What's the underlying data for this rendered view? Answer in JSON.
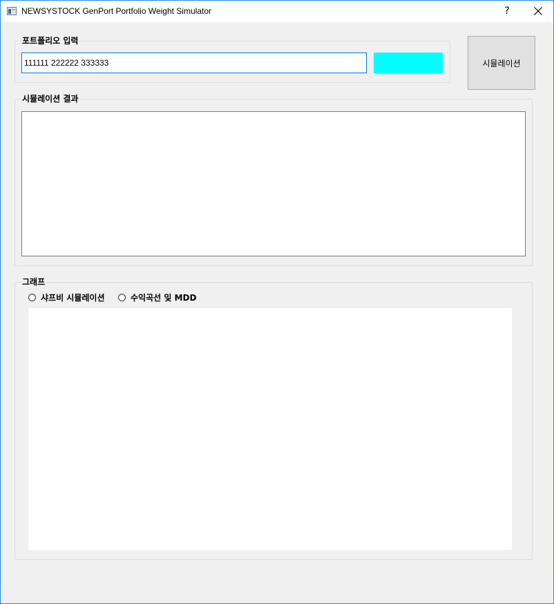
{
  "window": {
    "title": "NEWSYSTOCK GenPort Portfolio Weight Simulator",
    "help_label": "?",
    "accent_color": "#1e88e5"
  },
  "portfolio_group": {
    "title": "포트폴리오 입력",
    "input_value": "111111 222222 333333",
    "indicator_color": "#00ffff"
  },
  "simulate_button": {
    "label": "시뮬레이션"
  },
  "result_group": {
    "title": "시뮬레이션 결과",
    "result_text": ""
  },
  "graph_group": {
    "title": "그래프",
    "options": [
      {
        "label": "샤프비 시뮬레이션",
        "selected": false
      },
      {
        "label": "수익곡선 및 MDD",
        "selected": false
      }
    ]
  }
}
